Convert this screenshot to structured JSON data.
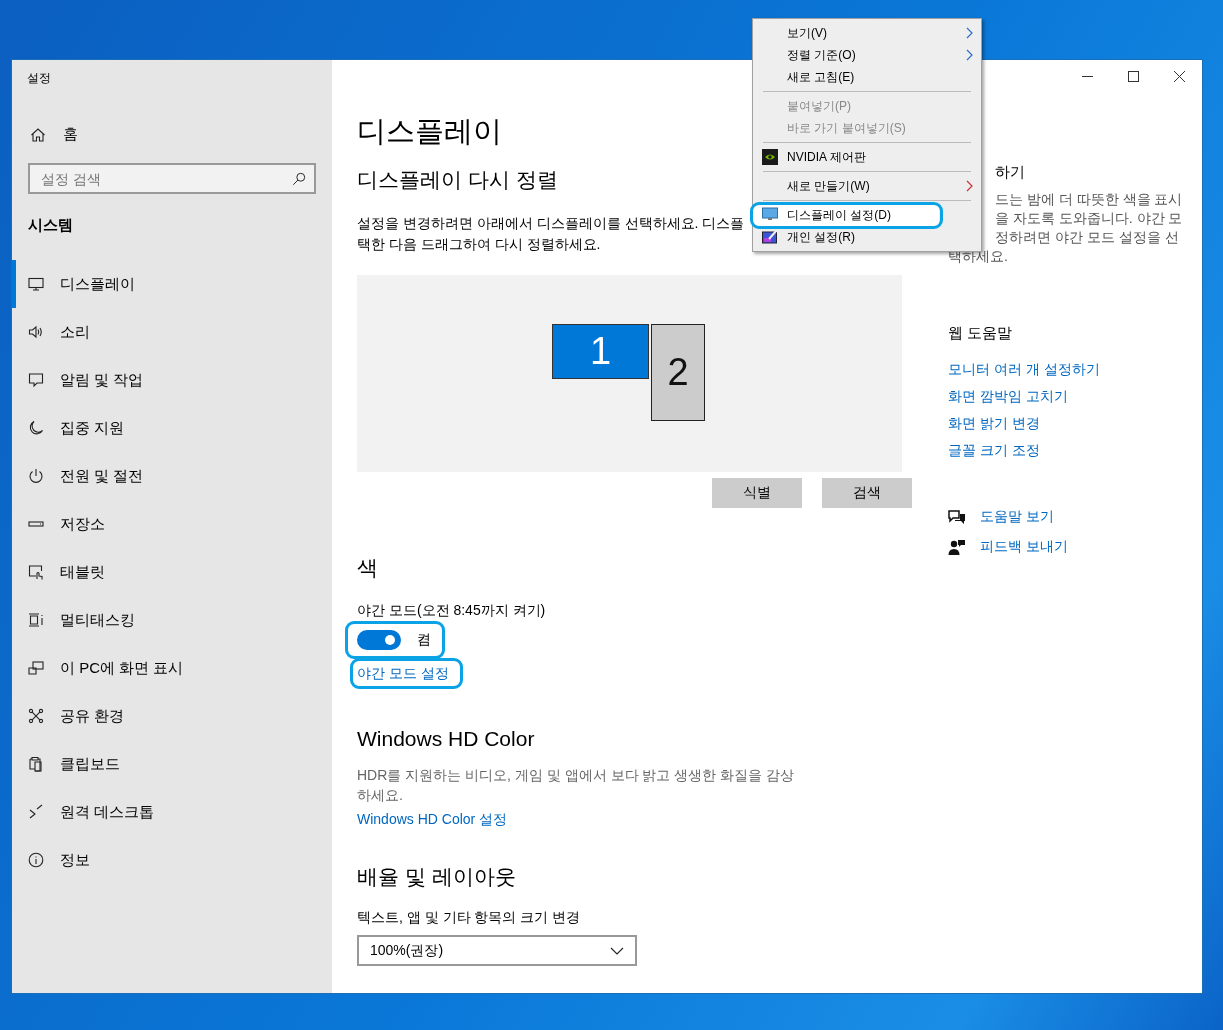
{
  "window": {
    "title": "설정"
  },
  "sidebar": {
    "home": "홈",
    "search": {
      "placeholder": "설정 검색"
    },
    "section": "시스템",
    "items": [
      {
        "label": "디스플레이",
        "selected": true
      },
      {
        "label": "소리",
        "selected": false
      },
      {
        "label": "알림 및 작업",
        "selected": false
      },
      {
        "label": "집중 지원",
        "selected": false
      },
      {
        "label": "전원 및 절전",
        "selected": false
      },
      {
        "label": "저장소",
        "selected": false
      },
      {
        "label": "태블릿",
        "selected": false
      },
      {
        "label": "멀티태스킹",
        "selected": false
      },
      {
        "label": "이 PC에 화면 표시",
        "selected": false
      },
      {
        "label": "공유 환경",
        "selected": false
      },
      {
        "label": "클립보드",
        "selected": false
      },
      {
        "label": "원격 데스크톱",
        "selected": false
      },
      {
        "label": "정보",
        "selected": false
      }
    ]
  },
  "main": {
    "title": "디스플레이",
    "arrange": {
      "heading": "디스플레이 다시 정렬",
      "description_lines": [
        "설정을 변경하려면 아래에서 디스플레이를 선택하세요. 디스플",
        "택한 다음 드래그하여 다시 정렬하세요."
      ],
      "displays": [
        {
          "label": "1",
          "selected": true
        },
        {
          "label": "2",
          "selected": false
        }
      ],
      "buttons": [
        "식별",
        "검색"
      ]
    },
    "color": {
      "heading": "색",
      "night_light": {
        "label": "야간 모드(오전 8:45까지 켜기)",
        "on": true,
        "state_text": "켬",
        "circled": true
      },
      "link": {
        "label": "야간 모드 설정",
        "circled": true
      }
    },
    "hd_color": {
      "heading": "Windows HD Color",
      "description": "HDR를 지원하는 비디오, 게임 및 앱에서 보다 밝고 생생한 화질을 감상하세요.",
      "link": "Windows HD Color 설정"
    },
    "scale": {
      "heading": "배율 및 레이아웃",
      "label": "텍스트, 앱 및 기타 항목의 크기 변경",
      "dropdown": {
        "value": "100%(권장)"
      }
    }
  },
  "right": {
    "tip": {
      "heading": "하기",
      "cut_lines": [
        "드는 밤에 더 따뜻한 색을 표시",
        "을 자도록 도와줍니다. 야간 모",
        "정하려면 야간 모드 설정을 선"
      ],
      "last_line": "택하세요."
    },
    "web_help": {
      "heading": "웹 도움말",
      "links": [
        "모니터 여러 개 설정하기",
        "화면 깜박임 고치기",
        "화면 밝기 변경",
        "글꼴 크기 조정"
      ]
    },
    "help": [
      "도움말 보기",
      "피드백 보내기"
    ]
  },
  "context_menu": {
    "items": [
      {
        "kind": "item",
        "label": "보기(V)",
        "submenu": true,
        "disabled": false,
        "selected": false,
        "circled": false
      },
      {
        "kind": "item",
        "label": "정렬 기준(O)",
        "submenu": true,
        "disabled": false,
        "selected": false,
        "circled": false
      },
      {
        "kind": "item",
        "label": "새로 고침(E)",
        "submenu": false,
        "disabled": false,
        "selected": false,
        "circled": false
      },
      {
        "kind": "separator"
      },
      {
        "kind": "item",
        "label": "붙여넣기(P)",
        "submenu": false,
        "disabled": true,
        "selected": false,
        "circled": false
      },
      {
        "kind": "item",
        "label": "바로 가기 붙여넣기(S)",
        "submenu": false,
        "disabled": true,
        "selected": false,
        "circled": false
      },
      {
        "kind": "separator"
      },
      {
        "kind": "item",
        "label": "NVIDIA 제어판",
        "submenu": false,
        "disabled": false,
        "selected": false,
        "circled": false
      },
      {
        "kind": "separator"
      },
      {
        "kind": "item",
        "label": "새로 만들기(W)",
        "submenu": true,
        "disabled": false,
        "selected": false,
        "circled": false
      },
      {
        "kind": "separator"
      },
      {
        "kind": "item",
        "label": "디스플레이 설정(D)",
        "submenu": false,
        "disabled": false,
        "selected": true,
        "circled": true
      },
      {
        "kind": "item",
        "label": "개인 설정(R)",
        "submenu": false,
        "disabled": false,
        "selected": false,
        "circled": false
      }
    ]
  }
}
